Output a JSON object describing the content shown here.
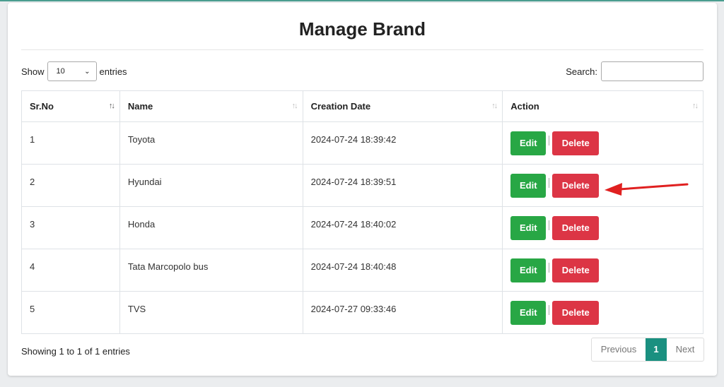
{
  "page": {
    "title": "Manage Brand"
  },
  "length_control": {
    "prefix": "Show",
    "value": "10",
    "suffix": "entries"
  },
  "search": {
    "label": "Search:",
    "value": ""
  },
  "table": {
    "columns": [
      "Sr.No",
      "Name",
      "Creation Date",
      "Action"
    ],
    "rows": [
      {
        "sr": "1",
        "name": "Toyota",
        "date": "2024-07-24 18:39:42"
      },
      {
        "sr": "2",
        "name": "Hyundai",
        "date": "2024-07-24 18:39:51"
      },
      {
        "sr": "3",
        "name": "Honda",
        "date": "2024-07-24 18:40:02"
      },
      {
        "sr": "4",
        "name": "Tata Marcopolo bus",
        "date": "2024-07-24 18:40:48"
      },
      {
        "sr": "5",
        "name": "TVS",
        "date": "2024-07-27 09:33:46"
      }
    ],
    "edit_label": "Edit",
    "delete_label": "Delete"
  },
  "footer": {
    "info": "Showing 1 to 1 of 1 entries"
  },
  "pagination": {
    "previous": "Previous",
    "current": "1",
    "next": "Next"
  },
  "colors": {
    "edit": "#28a745",
    "delete": "#dc3545",
    "active_page": "#1a9080",
    "annotation_arrow": "#e02020"
  },
  "annotation": {
    "icon": "red-arrow-icon",
    "points_to": "row 2 delete button"
  }
}
